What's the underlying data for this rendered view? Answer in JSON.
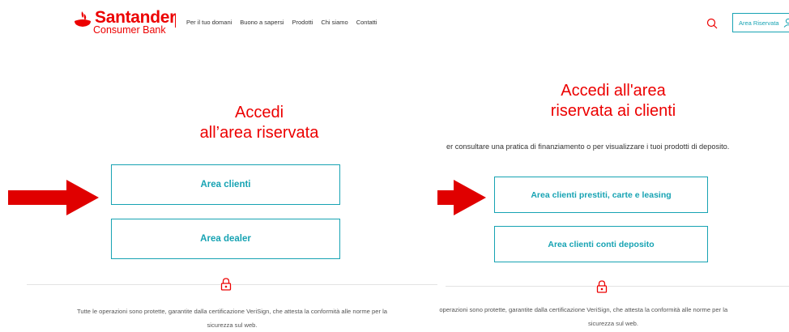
{
  "header": {
    "brand": "Santander",
    "brand_sub": "Consumer Bank",
    "nav": [
      "Per il tuo domani",
      "Buono a sapersi",
      "Prodotti",
      "Chi siamo",
      "Contatti"
    ],
    "reserved_button": "Area Riservata"
  },
  "left": {
    "title_line1": "Accedi",
    "title_line2": "all’area riservata",
    "btn_clienti": "Area clienti",
    "btn_dealer": "Area dealer",
    "footer_line1": "Tutte le operazioni sono protette, garantite dalla certificazione VeriSign, che attesta la conformità alle norme per la",
    "footer_line2": "sicurezza sul web."
  },
  "right": {
    "title_line1": "Accedi all'area",
    "title_line2": "riservata ai clienti",
    "subtext": "er consultare una pratica di finanziamento o per visualizzare i tuoi prodotti di deposito.",
    "btn_prestiti": "Area clienti prestiti, carte e leasing",
    "btn_conti": "Area clienti conti deposito",
    "footer_line1": "e operazioni sono protette, garantite dalla certificazione VeriSign, che attesta la conformità alle norme per la",
    "footer_line2": "sicurezza sul web."
  },
  "colors": {
    "brand_red": "#ec0000",
    "accent_teal": "#17a3b3",
    "arrow_red": "#e00000"
  },
  "icons": [
    "santander-flame-icon",
    "search-icon",
    "user-icon",
    "padlock-icon",
    "right-arrow-icon"
  ]
}
